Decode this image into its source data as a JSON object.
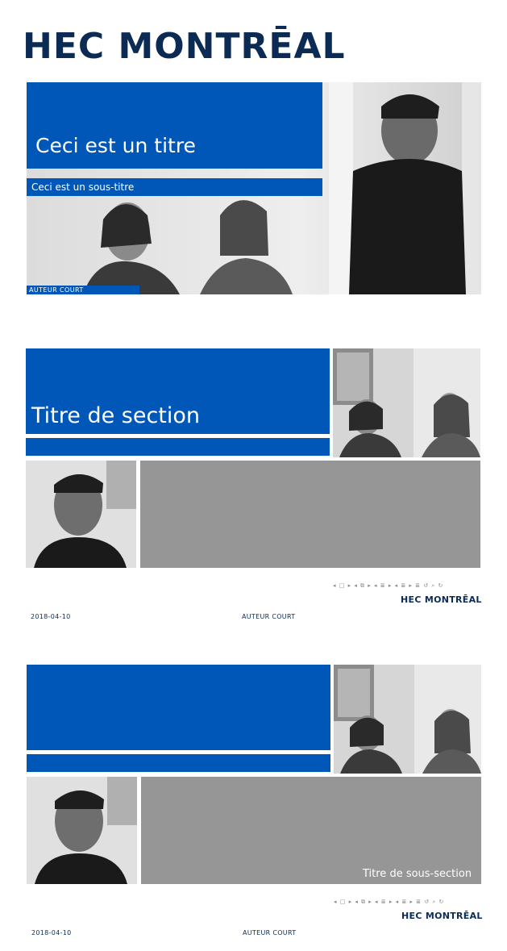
{
  "header": {
    "logo_text": "HEC MONTRĒAL"
  },
  "slide1": {
    "title": "Ceci est un titre",
    "subtitle": "Ceci est un sous-titre",
    "author": "AUTEUR COURT"
  },
  "slide2": {
    "section_title": "Titre de section",
    "nav_symbols": "◂ □ ▸  ◂ ⧉ ▸  ◂ ≣ ▸  ◂ ≣ ▸   ≣   ↺ ⌕ ↻",
    "logo_text": "HEC MONTRĒAL",
    "date": "2018-04-10",
    "author": "AUTEUR COURT"
  },
  "slide3": {
    "subsection_title": "Titre de sous-section",
    "nav_symbols": "◂ □ ▸  ◂ ⧉ ▸  ◂ ≣ ▸  ◂ ≣ ▸   ≣   ↺ ⌕ ↻",
    "logo_text": "HEC MONTRĒAL",
    "date": "2018-04-10",
    "author": "AUTEUR COURT"
  },
  "colors": {
    "brand_blue": "#0057b8",
    "logo_navy": "#0b2b55",
    "panel_grey": "#969696"
  },
  "icons": [
    "people-photo",
    "beamer-navigation-icons"
  ]
}
